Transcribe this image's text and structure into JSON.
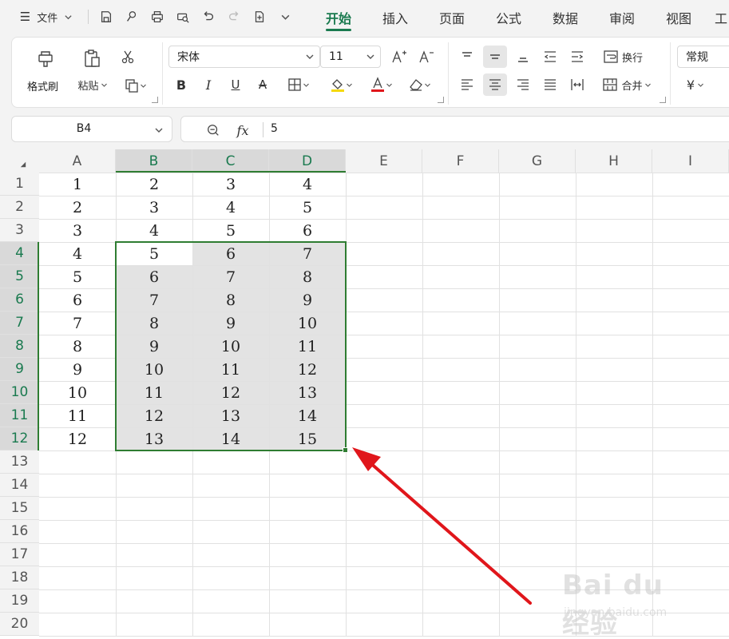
{
  "topbar": {
    "menu_label": "文件",
    "tabs": [
      {
        "label": "开始",
        "active": true
      },
      {
        "label": "插入",
        "active": false
      },
      {
        "label": "页面",
        "active": false
      },
      {
        "label": "公式",
        "active": false
      },
      {
        "label": "数据",
        "active": false
      },
      {
        "label": "审阅",
        "active": false
      },
      {
        "label": "视图",
        "active": false
      },
      {
        "label": "工",
        "active": false
      }
    ],
    "quick_access_icons": [
      "save-icon",
      "brush-icon",
      "print-icon",
      "print-preview-icon",
      "undo-icon",
      "redo-icon",
      "new-file-icon",
      "more-chevron-icon"
    ]
  },
  "ribbon": {
    "format_painter_label": "格式刷",
    "paste_label": "粘贴",
    "font_name": "宋体",
    "font_size": "11",
    "wrap_label": "换行",
    "merge_label": "合并",
    "number_format": "常规",
    "currency_symbol": "¥",
    "accent_colors": {
      "highlight": "#f5d90a",
      "font_color": "#e0161b"
    }
  },
  "formula_bar": {
    "name_box": "B4",
    "fx_label": "fx",
    "value": "5"
  },
  "sheet": {
    "columns": [
      "A",
      "B",
      "C",
      "D",
      "E",
      "F",
      "G",
      "H",
      "I"
    ],
    "row_numbers": [
      "1",
      "2",
      "3",
      "4",
      "5",
      "6",
      "7",
      "8",
      "9",
      "10",
      "11",
      "12",
      "13",
      "14",
      "15",
      "16",
      "17",
      "18",
      "19",
      "20"
    ],
    "data": [
      [
        "1",
        "2",
        "3",
        "4"
      ],
      [
        "2",
        "3",
        "4",
        "5"
      ],
      [
        "3",
        "4",
        "5",
        "6"
      ],
      [
        "4",
        "5",
        "6",
        "7"
      ],
      [
        "5",
        "6",
        "7",
        "8"
      ],
      [
        "6",
        "7",
        "8",
        "9"
      ],
      [
        "7",
        "8",
        "9",
        "10"
      ],
      [
        "8",
        "9",
        "10",
        "11"
      ],
      [
        "9",
        "10",
        "11",
        "12"
      ],
      [
        "10",
        "11",
        "12",
        "13"
      ],
      [
        "11",
        "12",
        "13",
        "14"
      ],
      [
        "12",
        "13",
        "14",
        "15"
      ]
    ],
    "selection": {
      "range": "B4:D12",
      "active_cell": "B4"
    },
    "selection_color": "#2f7d32"
  },
  "annotation": {
    "arrow_color": "#e0161b"
  },
  "watermark": {
    "line1": "Bai du 经验",
    "line2": "jingyan.baidu.com"
  }
}
